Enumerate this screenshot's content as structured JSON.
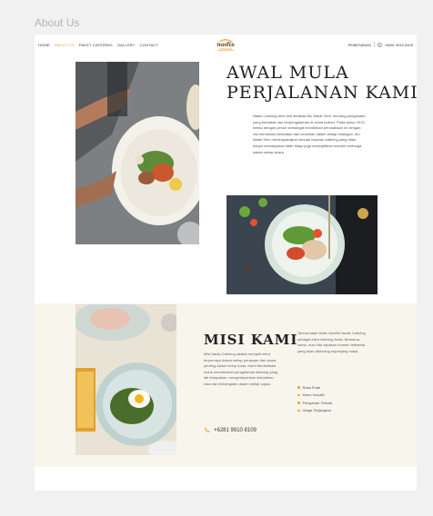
{
  "page_label": "About Us",
  "nav": {
    "items": [
      {
        "label": "HOME",
        "active": false
      },
      {
        "label": "ABOUT US",
        "active": true
      },
      {
        "label": "PAKET CATERING",
        "active": false
      },
      {
        "label": "GALLERY",
        "active": false
      },
      {
        "label": "CONTACT",
        "active": false
      }
    ]
  },
  "brand": {
    "name": "nadis",
    "sub": "CATERING"
  },
  "header_right": {
    "order_label": "PEMESANAN",
    "phone": "+6281 9910 8109"
  },
  "about": {
    "heading_lines": [
      "AWAL MULA",
      "PERJALANAN KAMI"
    ],
    "paragraph": "Nadis Catering lahir dari dedikasi Ibu Wade Seni, seorang pengusaha yang berbakat dan berpengalaman di dunia kuliner. Pada tahun 2010, beliau dengan penuh semangat mendirikan perusahaan ini dengan visi membawa kelezatan dan keunikan dalam setiap hidangan. Ibu Wade Seni membayangkan sebuah layanan katering yang tidak hanya memanjakan lidah tetapi juga menciptakan momen berharga dalam setiap acara."
  },
  "mission": {
    "heading": "MISI KAMI",
    "paragraph": "Misi Nadis Catering adalah menjadi mitra terpercaya dalam setiap perayaan dan acara penting dalam hidup Anda. Kami berdedikasi untuk memberikan pengalaman katering yang tak terlupakan, mengedepankan keindahan rasa dan kehangatan dalam setiap sajian.",
    "phone": "+6281 9910 8109",
    "side_paragraph": "Terima kasih telah memilih Nadis Catering sebagai mitra katering Anda. Bersama-sama, mari kita ciptakan momen istimewa yang akan dikenang sepanjang masa.",
    "features": [
      "Rasa Enak",
      "Menu Inovatif",
      "Pelayanan Terbaik",
      "Harga Terjangkau"
    ]
  },
  "colors": {
    "accent": "#e7a43a",
    "section_bg": "#f7f5ec",
    "text_dark": "#222222"
  },
  "icons": {
    "whatsapp": "whatsapp-icon",
    "phone": "phone-icon",
    "bullet": "bullet-icon"
  }
}
